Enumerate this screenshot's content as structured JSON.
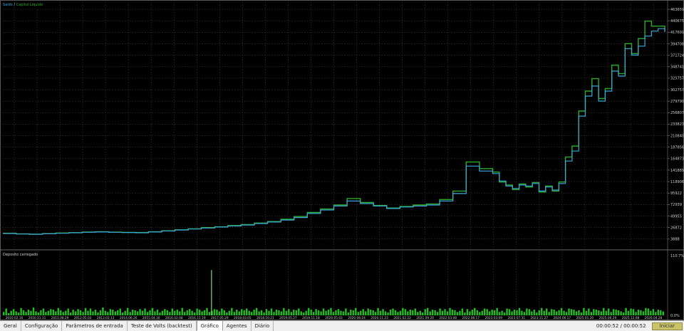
{
  "colors": {
    "background": "#000000",
    "grid": "#3a3a3a",
    "balance": "#2aaa2a",
    "equity": "#3aa6d8",
    "volume": "#22bb22",
    "spike": "#7fdc7f",
    "axis_text": "#cfcfcf",
    "start_button": "#c9c36a"
  },
  "tabs": [
    {
      "label": "Geral",
      "active": false
    },
    {
      "label": "Configuração",
      "active": false
    },
    {
      "label": "Parâmetros de entrada",
      "active": false
    },
    {
      "label": "Teste de Volts (backtest)",
      "active": false
    },
    {
      "label": "Gráfico",
      "active": true
    },
    {
      "label": "Agentes",
      "active": false
    },
    {
      "label": "Diário",
      "active": false
    }
  ],
  "status": {
    "elapsed": "00:00:52 / 00:00:52",
    "start_label": "Iniciar"
  },
  "chart_data": [
    {
      "type": "line",
      "legend": [
        {
          "name": "Saldo",
          "color": "#3aa6d8"
        },
        {
          "name": "Capital Líquido",
          "color": "#2aaa2a"
        }
      ],
      "legend_separator": " / ",
      "y_ticks": [
        3888,
        26872,
        49955,
        72939,
        95922,
        118906,
        141889,
        164873,
        187856,
        210840,
        233823,
        256807,
        279790,
        302757,
        325757,
        348741,
        371724,
        394708,
        417691,
        440675,
        463659
      ],
      "ylim": [
        -10600,
        478000
      ],
      "x_ticks": [
        "2010.02.16",
        "2010.11.11",
        "2011.08.29",
        "2012.05.03",
        "2013.03.13",
        "2014.06.26",
        "2015.04.30",
        "2016.02.08",
        "2016.11.19",
        "2017.05.29",
        "2018.03.05",
        "2018.10.21",
        "2019.05.27",
        "2019.11.18",
        "2020.05.03",
        "2020.08.24",
        "2020.11.23",
        "2021.02.22",
        "2021.09.20",
        "2022.03.08",
        "2022.08.17",
        "2023.03.09",
        "2023.07.31",
        "2023.11.27",
        "2024.06.17",
        "2025.01.20",
        "2025.06.29",
        "2025.12.08",
        "2026.04.28"
      ],
      "x": [
        0,
        0.02,
        0.04,
        0.06,
        0.08,
        0.1,
        0.12,
        0.14,
        0.16,
        0.18,
        0.2,
        0.22,
        0.24,
        0.26,
        0.28,
        0.3,
        0.32,
        0.34,
        0.36,
        0.38,
        0.4,
        0.42,
        0.44,
        0.46,
        0.48,
        0.5,
        0.52,
        0.54,
        0.56,
        0.58,
        0.6,
        0.62,
        0.64,
        0.66,
        0.68,
        0.7,
        0.72,
        0.74,
        0.75,
        0.76,
        0.77,
        0.78,
        0.79,
        0.8,
        0.81,
        0.82,
        0.83,
        0.84,
        0.85,
        0.86,
        0.87,
        0.88,
        0.89,
        0.9,
        0.91,
        0.92,
        0.93,
        0.94,
        0.95,
        0.96,
        0.97,
        0.98,
        0.99,
        1.0
      ],
      "series": [
        {
          "name": "Saldo",
          "values": [
            15000,
            14000,
            13500,
            14500,
            15500,
            16500,
            17500,
            18000,
            17500,
            17000,
            16500,
            18000,
            20000,
            22000,
            24000,
            26000,
            28000,
            30000,
            32000,
            35000,
            38000,
            42000,
            47000,
            55000,
            62000,
            70000,
            80000,
            75000,
            70000,
            65000,
            68000,
            70000,
            72000,
            80000,
            95000,
            150000,
            140000,
            135000,
            120000,
            110000,
            105000,
            112000,
            110000,
            115000,
            100000,
            108000,
            102000,
            115000,
            160000,
            180000,
            250000,
            290000,
            310000,
            280000,
            300000,
            340000,
            330000,
            385000,
            372000,
            390000,
            410000,
            420000,
            425000,
            418000
          ]
        },
        {
          "name": "Capital Líquido",
          "values": [
            15500,
            14200,
            13800,
            14800,
            16000,
            16800,
            18000,
            18500,
            17800,
            17200,
            17000,
            18500,
            20500,
            22500,
            24500,
            26800,
            28500,
            31000,
            33000,
            36000,
            39000,
            43500,
            49000,
            57000,
            64000,
            72000,
            85000,
            77000,
            71000,
            66000,
            69000,
            72000,
            74000,
            83000,
            100000,
            158000,
            145000,
            138000,
            118000,
            112000,
            103000,
            114000,
            108000,
            117000,
            98000,
            110000,
            100000,
            118000,
            168000,
            190000,
            260000,
            300000,
            325000,
            285000,
            305000,
            352000,
            335000,
            395000,
            375000,
            405000,
            440000,
            430000,
            430000,
            420000
          ]
        }
      ]
    },
    {
      "type": "bar",
      "title": "Deposito carregado",
      "y_ticks": [
        "0.0%",
        "110.7%"
      ],
      "ylim": [
        0,
        110.7
      ],
      "values": [
        6,
        12,
        4,
        8,
        11,
        7,
        5,
        13,
        9,
        6,
        10,
        8,
        14,
        7,
        5,
        9,
        12,
        6,
        8,
        11,
        10,
        7,
        13,
        9,
        6,
        8,
        12,
        5,
        10,
        7,
        11,
        9,
        6,
        13,
        8,
        12,
        7,
        10,
        5,
        9,
        14,
        8,
        6,
        11,
        10,
        7,
        9,
        12,
        5,
        8,
        13,
        6,
        10,
        9,
        7,
        11,
        8,
        12,
        6,
        9,
        13,
        7,
        10,
        5,
        8,
        11,
        9,
        6,
        12,
        8,
        10,
        7,
        13,
        6,
        9,
        11,
        8,
        5,
        12,
        10,
        7,
        9,
        13,
        6,
        8,
        11,
        10,
        7,
        12,
        9,
        5,
        8,
        13,
        6,
        10,
        7,
        11,
        9,
        12,
        8,
        6,
        10,
        13,
        7,
        9,
        5,
        11,
        8,
        12,
        6,
        10,
        9,
        7,
        13,
        8,
        11,
        6,
        10,
        9,
        12,
        7,
        5,
        8,
        13,
        10,
        6,
        11,
        9,
        7,
        12,
        8,
        10,
        13,
        6,
        9,
        11,
        8,
        7,
        12,
        5,
        10,
        9,
        13,
        6,
        8,
        11,
        7,
        12,
        10,
        9,
        6,
        13,
        8,
        11,
        7,
        5,
        10,
        12,
        9,
        6,
        8,
        13,
        11,
        7,
        10,
        9,
        12,
        6,
        8,
        5,
        11,
        13,
        7,
        10,
        9,
        6,
        12,
        8,
        11,
        7,
        13,
        10,
        9,
        6,
        8,
        12,
        5,
        11,
        7,
        10,
        13,
        9,
        6,
        8,
        12,
        11,
        7,
        10,
        9,
        13,
        6,
        8,
        5,
        12,
        11,
        7,
        10,
        9,
        13,
        8,
        6,
        12,
        11,
        7,
        10,
        5,
        9,
        13,
        8,
        12,
        6,
        11,
        10,
        7,
        9,
        13,
        8,
        6,
        12,
        11,
        10,
        7,
        9,
        5,
        13,
        8,
        12,
        6,
        11,
        10,
        9,
        7,
        13,
        8,
        12,
        6,
        11,
        10,
        9,
        7,
        5,
        13,
        8,
        12,
        11,
        6,
        10,
        9,
        7,
        13,
        12,
        8,
        11,
        6,
        10,
        9,
        7
      ],
      "spike_index": 84,
      "spike_value": 80
    }
  ]
}
